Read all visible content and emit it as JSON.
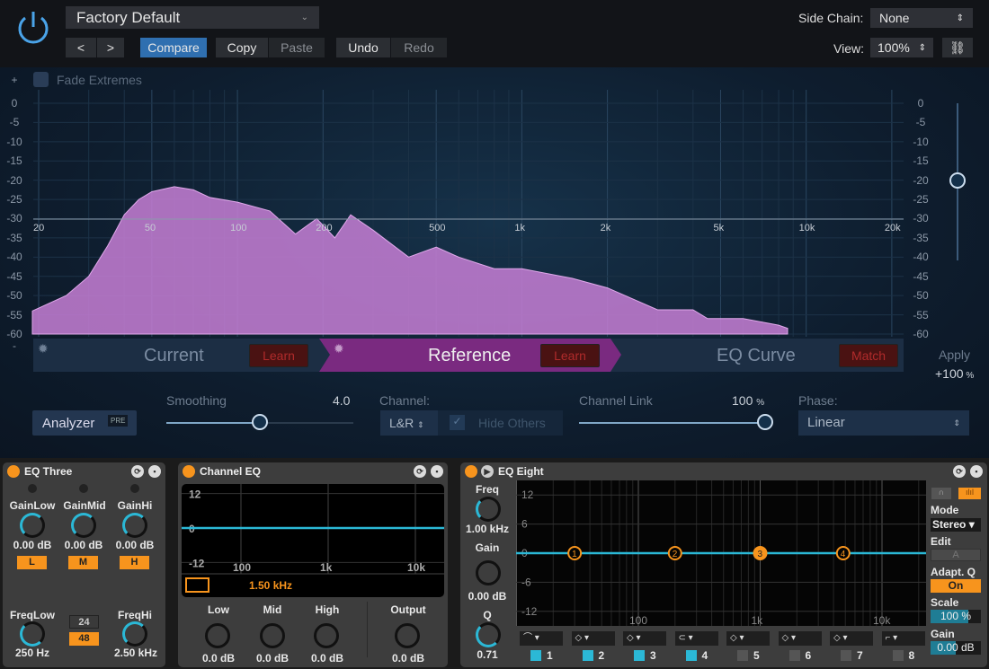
{
  "header": {
    "preset": "Factory Default",
    "prev": "<",
    "next": ">",
    "compare": "Compare",
    "copy": "Copy",
    "paste": "Paste",
    "undo": "Undo",
    "redo": "Redo",
    "side_chain_label": "Side Chain:",
    "side_chain_value": "None",
    "view_label": "View:",
    "view_value": "100%"
  },
  "analyzer": {
    "fade_extremes": "Fade Extremes",
    "plus": "+",
    "minus": "-",
    "db_ticks": [
      "0",
      "-5",
      "-10",
      "-15",
      "-20",
      "-25",
      "-30",
      "-35",
      "-40",
      "-45",
      "-50",
      "-55",
      "-60"
    ],
    "freq_ticks": [
      "20",
      "50",
      "100",
      "200",
      "500",
      "1k",
      "2k",
      "5k",
      "10k",
      "20k"
    ],
    "spectrum": [
      [
        19,
        -54
      ],
      [
        25,
        -50
      ],
      [
        30,
        -45
      ],
      [
        35,
        -37
      ],
      [
        40,
        -29
      ],
      [
        45,
        -25
      ],
      [
        50,
        -23
      ],
      [
        60,
        -21.7
      ],
      [
        70,
        -22.5
      ],
      [
        80,
        -24.5
      ],
      [
        100,
        -25.7
      ],
      [
        130,
        -28
      ],
      [
        160,
        -34
      ],
      [
        190,
        -30
      ],
      [
        220,
        -35
      ],
      [
        250,
        -29
      ],
      [
        300,
        -33
      ],
      [
        400,
        -40
      ],
      [
        500,
        -37.4
      ],
      [
        600,
        -40
      ],
      [
        800,
        -43
      ],
      [
        1000,
        -43
      ],
      [
        1500,
        -45.5
      ],
      [
        2000,
        -48
      ],
      [
        3000,
        -53.7
      ],
      [
        4000,
        -53.7
      ],
      [
        4500,
        -56
      ],
      [
        6000,
        -56
      ],
      [
        8000,
        -57.7
      ],
      [
        8600,
        -58.5
      ]
    ],
    "fill_color": "#c77fd6"
  },
  "tabs": {
    "current": "Current",
    "current_learn": "Learn",
    "reference": "Reference",
    "reference_learn": "Learn",
    "eq_curve": "EQ Curve",
    "match": "Match"
  },
  "apply": {
    "label": "Apply",
    "value": "+100",
    "unit": "%",
    "level": -20
  },
  "controls": {
    "analyzer": "Analyzer",
    "pre": "PRE",
    "smoothing_label": "Smoothing",
    "smoothing_value": "4.0",
    "smoothing_level": 0.5,
    "channel_label": "Channel:",
    "channel_value": "L&R",
    "hide_others": "Hide Others",
    "channel_link_label": "Channel Link",
    "channel_link_value": "100",
    "channel_link_unit": "%",
    "channel_link_level": 1.0,
    "phase_label": "Phase:",
    "phase_value": "Linear"
  },
  "eq_three": {
    "title": "EQ Three",
    "gain_low": "GainLow",
    "gain_mid": "GainMid",
    "gain_hi": "GainHi",
    "gain_low_value": "0.00 dB",
    "gain_mid_value": "0.00 dB",
    "gain_hi_value": "0.00 dB",
    "l": "L",
    "m": "M",
    "h": "H",
    "freq_low": "FreqLow",
    "freq_low_value": "250 Hz",
    "freq_hi": "FreqHi",
    "freq_hi_value": "2.50 kHz",
    "slope_24": "24",
    "slope_48": "48"
  },
  "channel_eq": {
    "title": "Channel EQ",
    "db_ticks": [
      "12",
      "0",
      "-12"
    ],
    "freq_ticks": [
      "100",
      "1k",
      "10k"
    ],
    "freq_readout": "1.50 kHz",
    "low": "Low",
    "mid": "Mid",
    "high": "High",
    "output": "Output",
    "low_value": "0.0 dB",
    "mid_value": "0.0 dB",
    "high_value": "0.0 dB",
    "output_value": "0.0 dB"
  },
  "eq_eight": {
    "title": "EQ Eight",
    "freq_label": "Freq",
    "freq_value": "1.00 kHz",
    "gain_label": "Gain",
    "gain_value": "0.00 dB",
    "q_label": "Q",
    "q_value": "0.71",
    "db_ticks": [
      "12",
      "6",
      "0",
      "-6",
      "-12"
    ],
    "freq_ticks": [
      "100",
      "1k",
      "10k"
    ],
    "nodes": [
      {
        "label": "1",
        "freq": 30
      },
      {
        "label": "2",
        "freq": 200
      },
      {
        "label": "3",
        "freq": 1000,
        "selected": true
      },
      {
        "label": "4",
        "freq": 4800
      }
    ],
    "bands": [
      "1",
      "2",
      "3",
      "4",
      "5",
      "6",
      "7",
      "8"
    ],
    "bands_on": [
      true,
      true,
      true,
      true,
      false,
      false,
      false,
      false
    ],
    "mode_label": "Mode",
    "mode_value": "Stereo",
    "edit_label": "Edit",
    "edit_value": "A",
    "adapt_q_label": "Adapt. Q",
    "adapt_q_value": "On",
    "scale_label": "Scale",
    "scale_value": "100 %",
    "out_gain_label": "Gain",
    "out_gain_value": "0.00 dB"
  },
  "colors": {
    "accent_orange": "#f7941d",
    "accent_cyan": "#2bb8d6",
    "reference_purple": "#7a2a80",
    "compare_blue": "#2f6fb0"
  }
}
